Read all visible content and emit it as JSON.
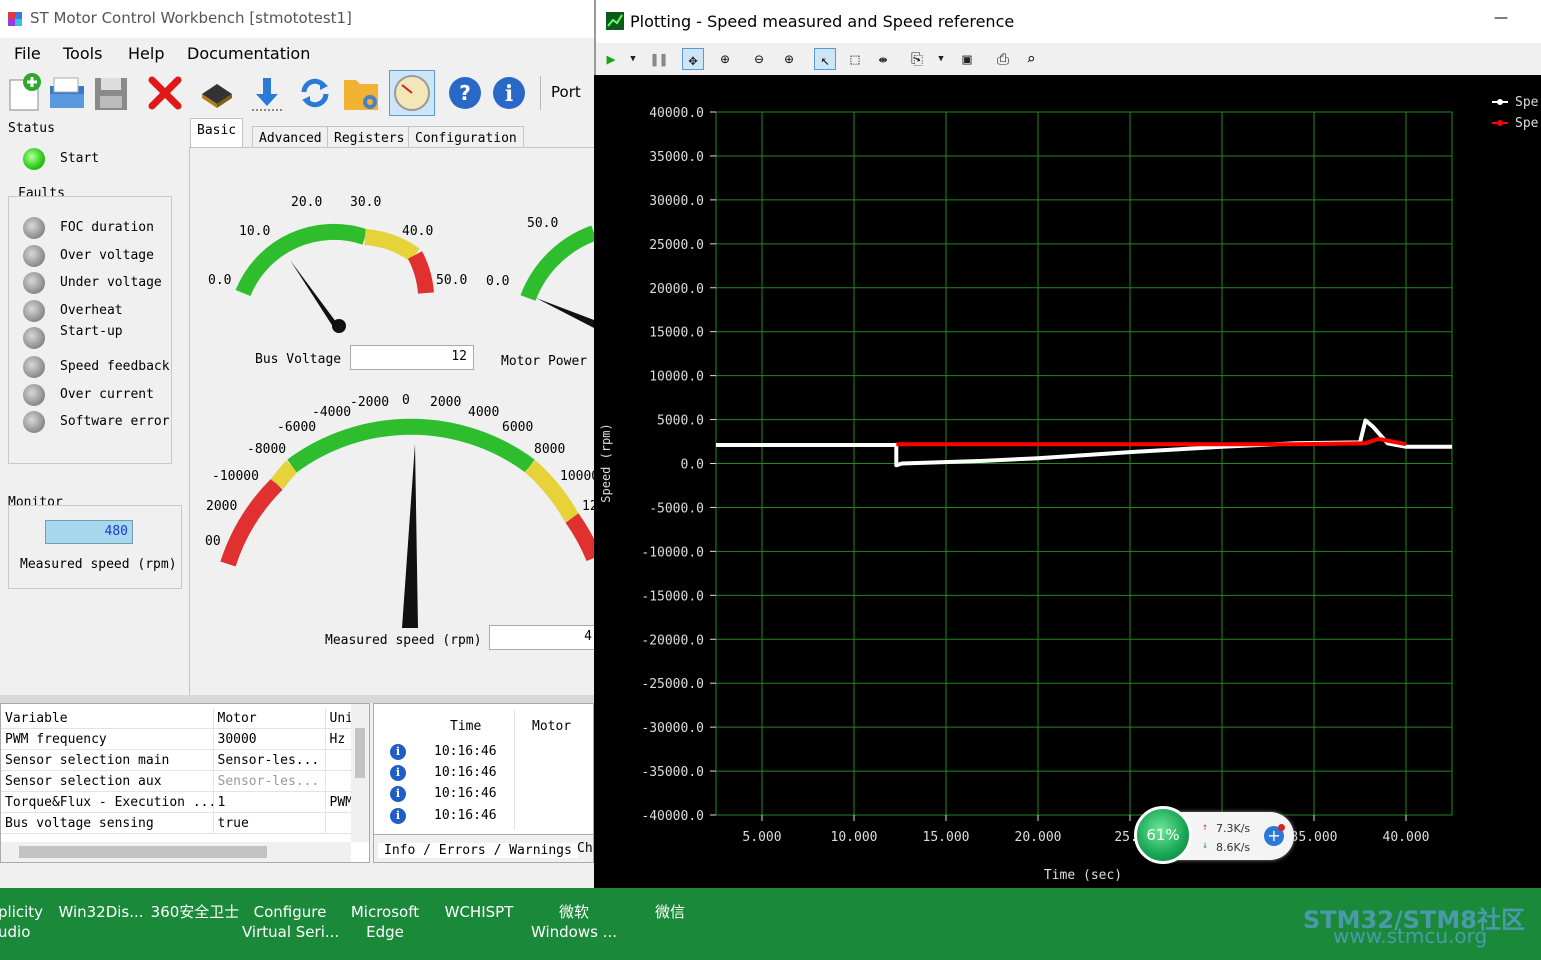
{
  "workbench": {
    "title": "ST Motor Control Workbench [stmototest1]",
    "menu": [
      "File",
      "Tools",
      "Help",
      "Documentation"
    ],
    "toolbar": {
      "icons": [
        "new-icon",
        "open-icon",
        "save-icon",
        "delete-icon",
        "chip-icon",
        "download-icon",
        "refresh-icon",
        "folder-settings-icon",
        "gauge-icon",
        "help-icon",
        "info-icon"
      ],
      "port_label": "Port"
    },
    "status": {
      "title": "Status",
      "start_label": "Start"
    },
    "faults": {
      "title": "Faults",
      "items": [
        "FOC duration",
        "Over voltage",
        "Under voltage",
        "Overheat",
        "Start-up",
        "Speed feedback",
        "Over current",
        "Software error"
      ]
    },
    "monitor": {
      "title": "Monitor",
      "value": "480",
      "label": "Measured speed (rpm)"
    },
    "tabs": [
      "Basic",
      "Advanced",
      "Registers",
      "Configuration"
    ],
    "gauges": {
      "bus_voltage": {
        "label": "Bus Voltage",
        "value": "12",
        "ticks": [
          "0.0",
          "10.0",
          "20.0",
          "30.0",
          "40.0",
          "50.0"
        ]
      },
      "motor_power": {
        "label": "Motor Power",
        "ticks": [
          "0.0",
          "50.0"
        ]
      },
      "speed": {
        "label": "Measured speed (rpm)",
        "value": "4",
        "ticks": [
          "00",
          "2000",
          "-10000",
          "-8000",
          "-6000",
          "-4000",
          "-2000",
          "0",
          "2000",
          "4000",
          "6000",
          "8000",
          "10000",
          "12"
        ]
      }
    },
    "vars_table": {
      "headers": [
        "Variable",
        "Motor",
        "Uni"
      ],
      "rows": [
        [
          "PWM frequency",
          "30000",
          "Hz"
        ],
        [
          "Sensor selection main",
          "Sensor-les...",
          ""
        ],
        [
          "Sensor selection aux",
          "Sensor-les...",
          ""
        ],
        [
          "Torque&Flux - Execution ...",
          "1",
          "PWM"
        ],
        [
          "Bus voltage sensing",
          "true",
          ""
        ]
      ]
    },
    "log": {
      "headers": [
        "Time",
        "Motor"
      ],
      "times": [
        "10:16:46",
        "10:16:46",
        "10:16:46",
        "10:16:46"
      ],
      "tabs": [
        "Info / Errors / Warnings",
        "Ch"
      ]
    }
  },
  "plot_window": {
    "title": "Plotting - Speed measured and Speed reference",
    "minimize_glyph": "—",
    "legend": [
      "Spe",
      "Spe"
    ],
    "chart_data": {
      "type": "line",
      "title": "",
      "xlabel": "Time (sec)",
      "ylabel": "Speed (rpm)",
      "xlim": [
        2.5,
        42.5
      ],
      "ylim": [
        -40000,
        40000
      ],
      "x_ticks": [
        "5.000",
        "10.000",
        "15.000",
        "20.000",
        "25.0",
        "35.000",
        "40.000"
      ],
      "y_ticks": [
        "40000.0",
        "35000.0",
        "30000.0",
        "25000.0",
        "20000.0",
        "15000.0",
        "10000.0",
        "5000.0",
        "0.0",
        "-5000.0",
        "-10000.0",
        "-15000.0",
        "-20000.0",
        "-25000.0",
        "-30000.0",
        "-35000.0",
        "-40000.0"
      ],
      "grid": true,
      "legend_position": "top-right",
      "series": [
        {
          "color": "#ffffff",
          "x": [
            2.5,
            12.3,
            12.3,
            12.6,
            17,
            20,
            25,
            30,
            34,
            37.5,
            37.8,
            38.2,
            39,
            40,
            42.5
          ],
          "y": [
            2100,
            2100,
            -200,
            0,
            300,
            600,
            1300,
            1900,
            2300,
            2400,
            4900,
            4200,
            2300,
            1900,
            1900
          ]
        },
        {
          "color": "#ff0000",
          "x": [
            12.3,
            20,
            25,
            30,
            34,
            37.8,
            38.5,
            40
          ],
          "y": [
            2200,
            2200,
            2200,
            2200,
            2200,
            2300,
            2800,
            2200
          ]
        }
      ]
    },
    "net_widget": {
      "percent": "61%",
      "up": "7.3K/s",
      "down": "8.6K/s"
    }
  },
  "taskbar": {
    "items": [
      {
        "line1": "plicity",
        "line2": "udio"
      },
      {
        "line1": "Win32Dis...",
        "line2": ""
      },
      {
        "line1": "360安全卫士",
        "line2": ""
      },
      {
        "line1": "Configure",
        "line2": "Virtual Seri..."
      },
      {
        "line1": "Microsoft",
        "line2": "Edge"
      },
      {
        "line1": "WCHISPT",
        "line2": ""
      },
      {
        "line1": "微软",
        "line2": "Windows ..."
      },
      {
        "line1": "微信",
        "line2": ""
      }
    ],
    "watermark": {
      "line1": "STM32/STM8社区",
      "line2": "www.stmcu.org"
    }
  }
}
